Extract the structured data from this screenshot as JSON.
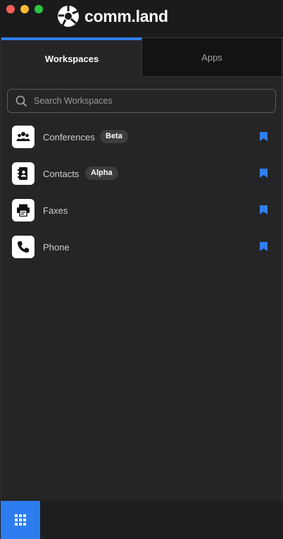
{
  "brand": {
    "name": "comm.land",
    "logo_icon": "comm-land-logo-icon"
  },
  "window": {
    "controls": [
      "close",
      "minimize",
      "maximize"
    ]
  },
  "tabs": [
    {
      "label": "Workspaces",
      "active": true
    },
    {
      "label": "Apps",
      "active": false
    }
  ],
  "search": {
    "placeholder": "Search Workspaces",
    "value": ""
  },
  "workspaces": [
    {
      "label": "Conferences",
      "icon": "users-group-icon",
      "badge": "Beta",
      "bookmarked": true
    },
    {
      "label": "Contacts",
      "icon": "address-book-icon",
      "badge": "Alpha",
      "bookmarked": true
    },
    {
      "label": "Faxes",
      "icon": "fax-icon",
      "badge": "",
      "bookmarked": true
    },
    {
      "label": "Phone",
      "icon": "phone-icon",
      "badge": "",
      "bookmarked": true
    }
  ],
  "colors": {
    "accent": "#2f7ff0",
    "background": "#252527",
    "titlebar": "#1b1b1d",
    "badge_bg": "#3d3d40"
  },
  "footer": {
    "apps_button_icon": "grid-icon"
  }
}
